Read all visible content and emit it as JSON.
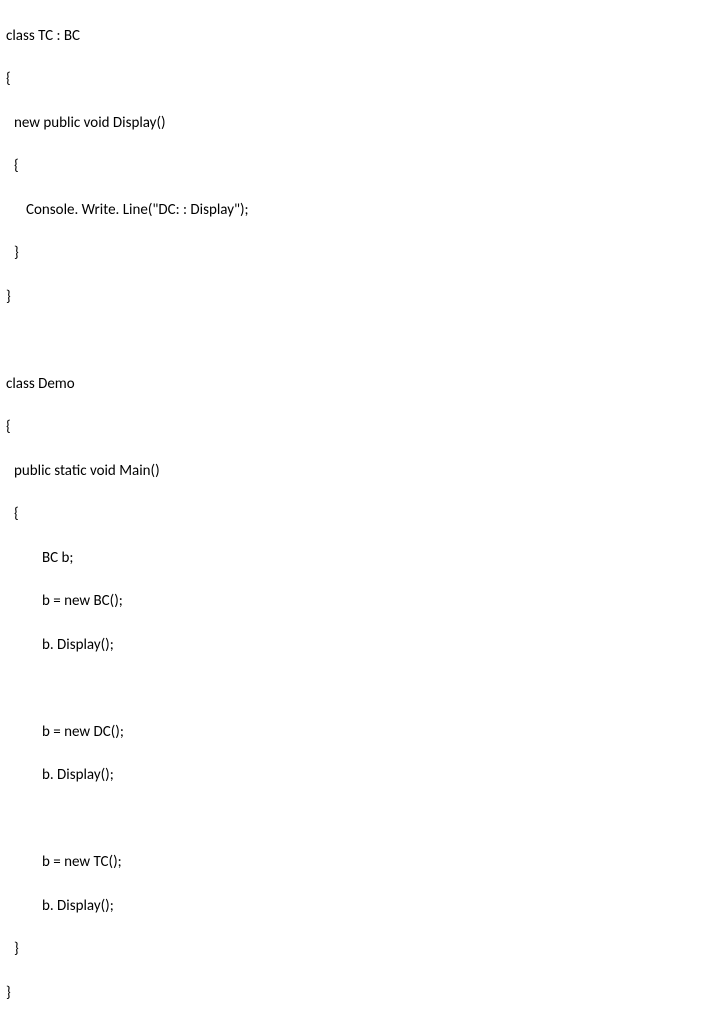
{
  "code": {
    "tc_decl": "class TC : BC",
    "open_brace": "{",
    "tc_method_decl": "new public void Display()",
    "inner_open_brace": "{",
    "tc_console": "Console. Write. Line(\"DC: : Display\");",
    "inner_close_brace": "}",
    "close_brace": "}",
    "demo_decl": "class Demo",
    "demo_open": "{",
    "main_decl": "public static void Main()",
    "main_open": "{",
    "bc_var": "BC b;",
    "bc_new": "b = new BC();",
    "bc_display": "b. Display();",
    "dc_new": "b = new DC();",
    "dc_display": "b. Display();",
    "tc_new": "b = new TC();",
    "tc_display2": "b. Display();",
    "main_close": "}",
    "demo_close": "}"
  }
}
